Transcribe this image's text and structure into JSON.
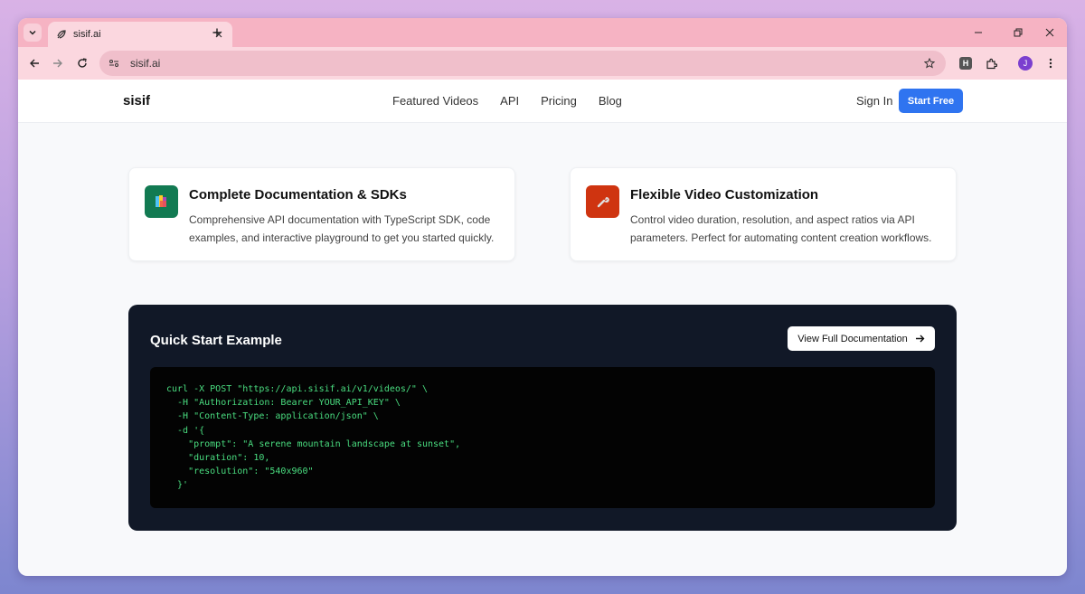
{
  "browser": {
    "tab_title": "sisif.ai",
    "url": "sisif.ai",
    "profile_initial": "J",
    "extension_label": "H"
  },
  "site": {
    "logo": "sisif",
    "nav": [
      "Featured Videos",
      "API",
      "Pricing",
      "Blog"
    ],
    "sign_in": "Sign In",
    "start_free": "Start Free"
  },
  "features": [
    {
      "title": "Complete Documentation & SDKs",
      "description": "Comprehensive API documentation with TypeScript SDK, code examples, and interactive playground to get you started quickly.",
      "icon": "books-icon",
      "icon_bg": "#127a52"
    },
    {
      "title": "Flexible Video Customization",
      "description": "Control video duration, resolution, and aspect ratios via API parameters. Perfect for automating content creation workflows.",
      "icon": "wrench-icon",
      "icon_bg": "#cf3410"
    }
  ],
  "quick_start": {
    "title": "Quick Start Example",
    "docs_button": "View Full Documentation",
    "code": "curl -X POST \"https://api.sisif.ai/v1/videos/\" \\\n  -H \"Authorization: Bearer YOUR_API_KEY\" \\\n  -H \"Content-Type: application/json\" \\\n  -d '{\n    \"prompt\": \"A serene mountain landscape at sunset\",\n    \"duration\": 10,\n    \"resolution\": \"540x960\"\n  }'"
  },
  "colors": {
    "accent": "#2f74f0",
    "code_text": "#4ade80",
    "dark_panel": "#111827"
  }
}
